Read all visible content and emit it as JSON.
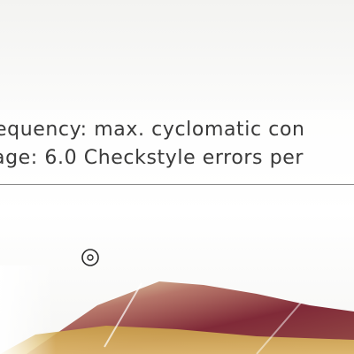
{
  "chart_data": {
    "type": "area",
    "legend": {
      "placement": "top",
      "lines": [
        "equency: max. cyclomatic con",
        "age: 6.0 Checkstyle errors per"
      ]
    },
    "marker": {
      "symbol": "circle-dot"
    },
    "colors": {
      "area_dark": "#7a1f2e",
      "area_mid": "#a04a3a",
      "area_gold": "#c9a048",
      "legend_text": "#3a3a3a",
      "legend_rule": "#8a8a8a"
    }
  }
}
